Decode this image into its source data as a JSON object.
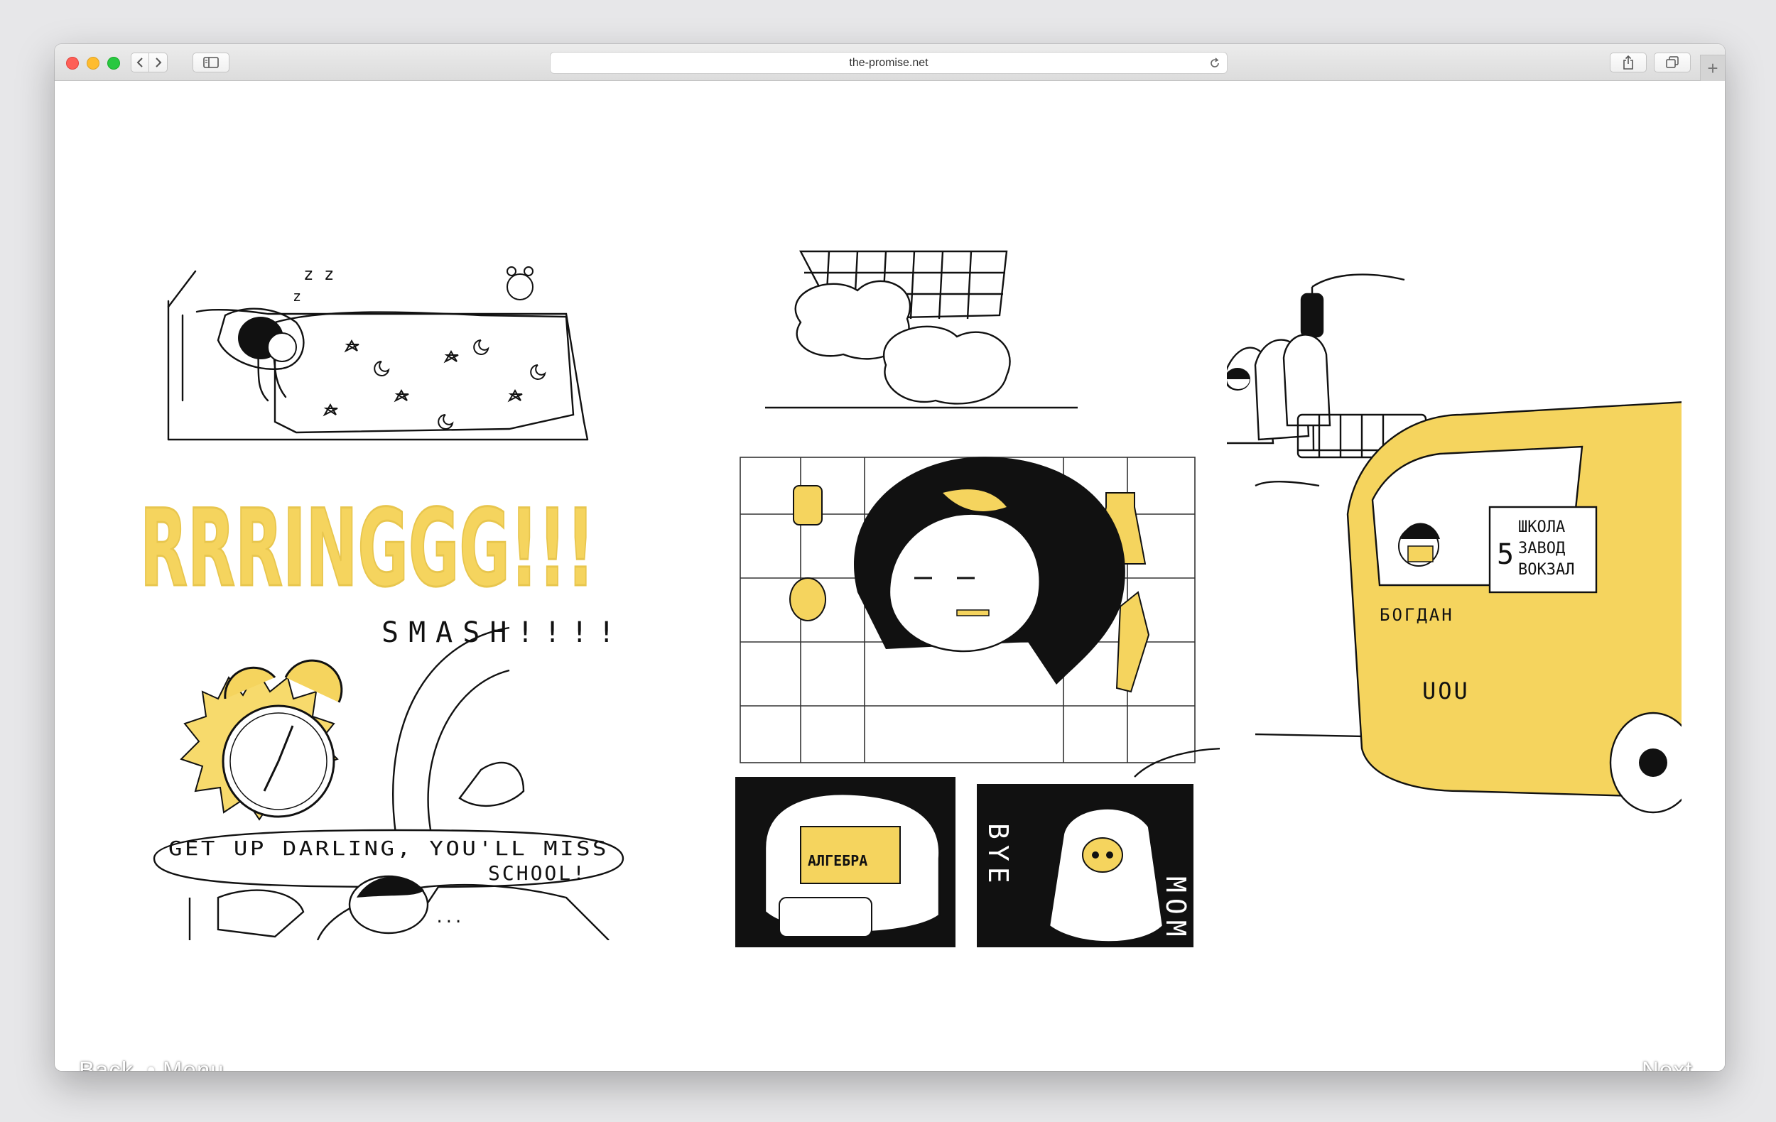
{
  "browser": {
    "url": "the-promise.net",
    "new_tab_symbol": "+",
    "toolbar_icons": [
      "back-chevron-icon",
      "forward-chevron-icon",
      "sidebar-icon",
      "reload-icon",
      "share-icon",
      "tabs-icon"
    ]
  },
  "comic": {
    "panel1": {
      "sound_effect": "RRRINGGG!!!",
      "smash_text": "SMASH!!!!",
      "bubble_line1": "GET UP DARLING, YOU'LL MISS",
      "bubble_line2": "SCHOOL!",
      "ellipsis": "..."
    },
    "panel2": {
      "book_label": "АЛГЕБРА",
      "bye_text": "BYE",
      "mom_text": "MOM!"
    },
    "panel3": {
      "bus_name": "БОГДАН",
      "route_number": "5",
      "route_line1": "ШКОЛА",
      "route_line2": "ЗАВОД",
      "route_line3": "ВОКЗАЛ",
      "plate": "UOU"
    },
    "accent_color": "#f5d45e",
    "ink_color": "#111111"
  },
  "nav": {
    "back": "Back",
    "separator": "•",
    "menu": "Menu",
    "next": "Next"
  }
}
